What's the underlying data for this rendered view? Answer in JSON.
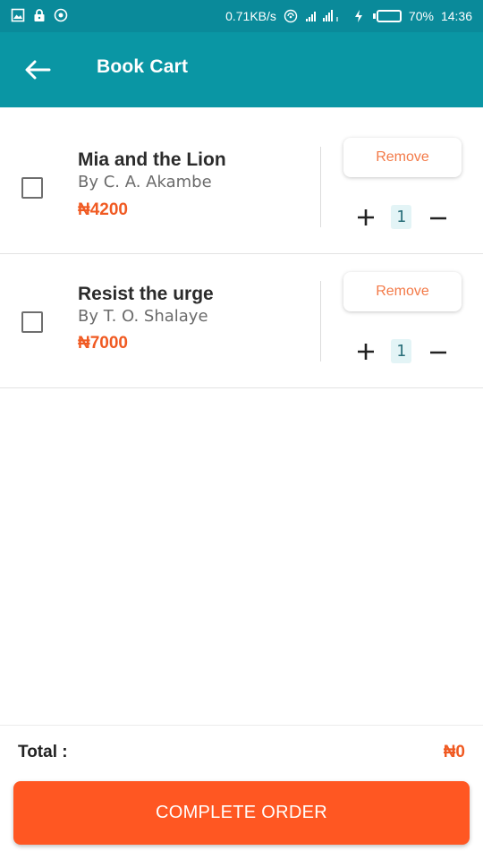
{
  "status_bar": {
    "net_speed": "0.71KB/s",
    "battery": "70%",
    "battery_level": 0.7,
    "time": "14:36"
  },
  "app_bar": {
    "title": "Book Cart",
    "back_icon": "arrow-left-icon"
  },
  "cart": {
    "items": [
      {
        "title": "Mia and the Lion",
        "author": "By C. A. Akambe",
        "price": "₦4200",
        "quantity": "1",
        "remove_label": "Remove",
        "checked": false
      },
      {
        "title": "Resist the urge",
        "author": "By T. O. Shalaye",
        "price": "₦7000",
        "quantity": "1",
        "remove_label": "Remove",
        "checked": false
      }
    ]
  },
  "summary": {
    "total_label": "Total :",
    "total_value": "₦0"
  },
  "actions": {
    "complete_label": "COMPLETE ORDER"
  },
  "colors": {
    "app_bar": "#0a96a4",
    "status_bar": "#0a8a9a",
    "accent": "#ff5722",
    "price": "#f05a22"
  }
}
